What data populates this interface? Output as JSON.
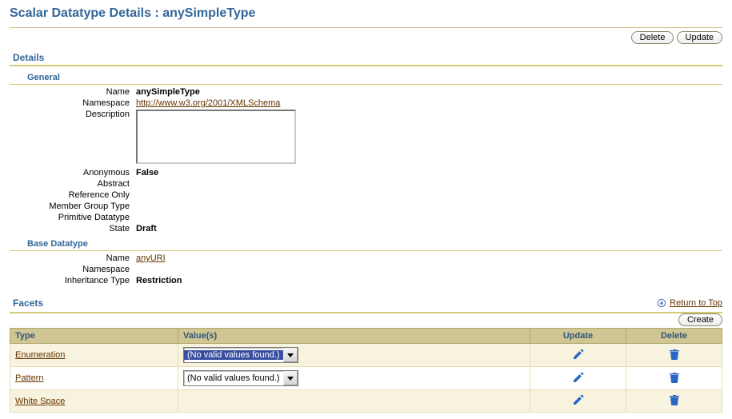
{
  "title": "Scalar Datatype Details : anySimpleType",
  "buttons": {
    "delete": "Delete",
    "update": "Update",
    "create": "Create"
  },
  "returnTop": "Return to Top",
  "details": {
    "heading": "Details",
    "generalHeading": "General",
    "labels": {
      "name": "Name",
      "namespace": "Namespace",
      "description": "Description",
      "anonymous": "Anonymous",
      "abstract": "Abstract",
      "referenceOnly": "Reference Only",
      "memberGroupType": "Member Group Type",
      "primitiveDatatype": "Primitive Datatype",
      "state": "State"
    },
    "general": {
      "name": "anySimpleType",
      "namespaceLink": "http://www.w3.org/2001/XMLSchema",
      "description": "",
      "anonymous": "False",
      "abstract": "",
      "referenceOnly": "",
      "memberGroupType": "",
      "primitiveDatatype": "",
      "state": "Draft"
    },
    "baseHeading": "Base Datatype",
    "baseLabels": {
      "name": "Name",
      "namespace": "Namespace",
      "inheritanceType": "Inheritance Type"
    },
    "base": {
      "nameLink": "anyURI",
      "namespace": "",
      "inheritanceType": "Restriction"
    }
  },
  "facets": {
    "heading": "Facets",
    "headers": {
      "type": "Type",
      "values": "Value(s)",
      "update": "Update",
      "delete": "Delete"
    },
    "noValid": "(No valid values found.)",
    "rows": [
      {
        "type": "Enumeration",
        "hasSelect": true,
        "highlight": true,
        "altRow": true
      },
      {
        "type": "Pattern",
        "hasSelect": true,
        "highlight": false,
        "altRow": false
      },
      {
        "type": "White Space",
        "hasSelect": false,
        "highlight": false,
        "altRow": true
      }
    ]
  }
}
